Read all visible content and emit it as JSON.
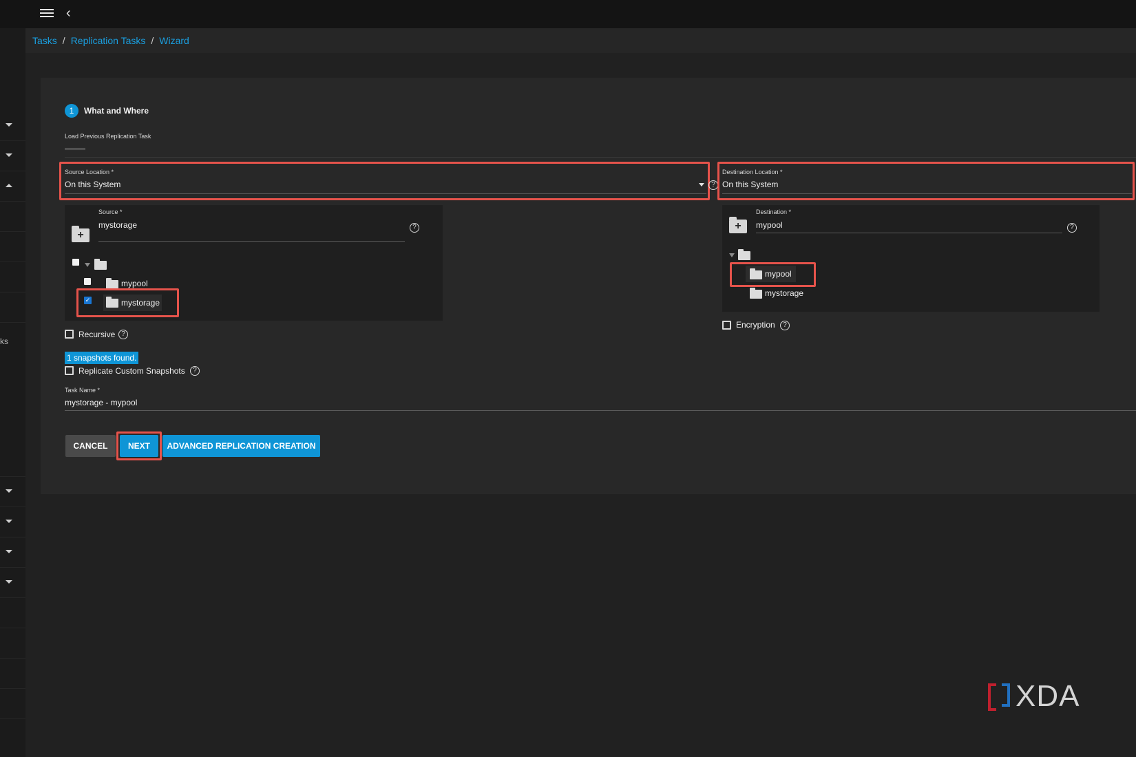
{
  "breadcrumb": [
    "Tasks",
    "Replication Tasks",
    "Wizard"
  ],
  "step": {
    "number": "1",
    "title": "What and Where"
  },
  "load_previous": {
    "label": "Load Previous Replication Task",
    "value": ""
  },
  "source_location": {
    "label": "Source Location *",
    "value": "On this System"
  },
  "destination_location": {
    "label": "Destination Location *",
    "value": "On this System"
  },
  "source": {
    "label": "Source *",
    "value": "mystorage",
    "tree": [
      {
        "name": "mypool",
        "checked": false
      },
      {
        "name": "mystorage",
        "checked": true
      }
    ]
  },
  "destination": {
    "label": "Destination *",
    "value": "mypool",
    "tree": [
      "mypool",
      "mystorage"
    ]
  },
  "recursive_label": "Recursive",
  "encryption_label": "Encryption",
  "snapshots_found": "1 snapshots found.",
  "replicate_custom_label": "Replicate Custom Snapshots",
  "task_name": {
    "label": "Task Name *",
    "value": "mystorage - mypool"
  },
  "buttons": {
    "cancel": "CANCEL",
    "next": "NEXT",
    "advanced": "ADVANCED REPLICATION CREATION"
  },
  "sidebar_cut_text": "ks",
  "watermark": "XDA",
  "colors": {
    "accent": "#0f95d6",
    "highlight_box": "#e5534b",
    "background": "#212121",
    "card": "#282828"
  }
}
